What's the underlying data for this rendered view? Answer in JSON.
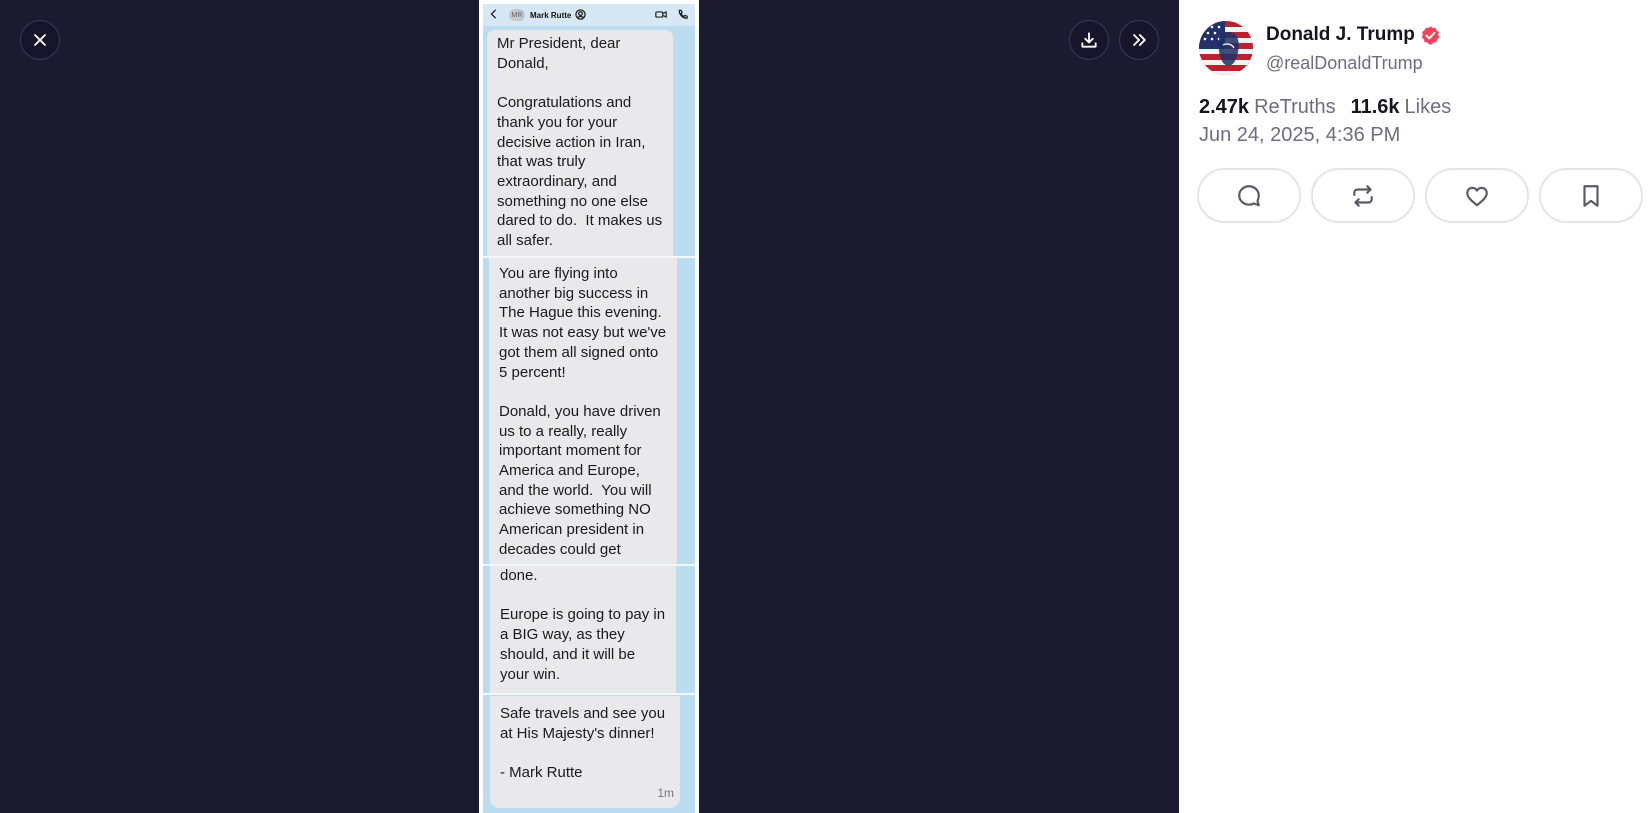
{
  "viewer": {
    "close_icon": "close-icon",
    "download_icon": "download-icon",
    "expand_icon": "chevrons-right-icon"
  },
  "screenshot": {
    "header": {
      "avatar_initials": "MR",
      "contact_name": "Mark Rutte"
    },
    "messages": [
      "Mr President, dear Donald,\n\nCongratulations and thank you for your decisive action in Iran, that was truly extraordinary, and something no one else dared to do.  It makes us all safer.",
      "You are flying into another big success in The Hague this evening. It was not easy but we've got them all signed onto 5 percent!\n\nDonald, you have driven us to a really, really important moment for America and Europe, and the world.  You will achieve something NO American president in decades could get",
      "done.\n\nEurope is going to pay in a BIG way, as they should, and it will be your win.",
      "Safe travels and see you at His Majesty's dinner!\n\n- Mark Rutte"
    ],
    "timestamp": "1m"
  },
  "post": {
    "author_name": "Donald J. Trump",
    "handle": "@realDonaldTrump",
    "retruths_count": "2.47k",
    "retruths_label": "ReTruths",
    "likes_count": "11.6k",
    "likes_label": "Likes",
    "date": "Jun 24, 2025, 4:36 PM",
    "verified_color": "#f2445d"
  },
  "colors": {
    "viewer_bg": "#1b1a2e",
    "imessage_bg": "#bcdcf0",
    "bubble_bg": "#e9e9eb"
  }
}
